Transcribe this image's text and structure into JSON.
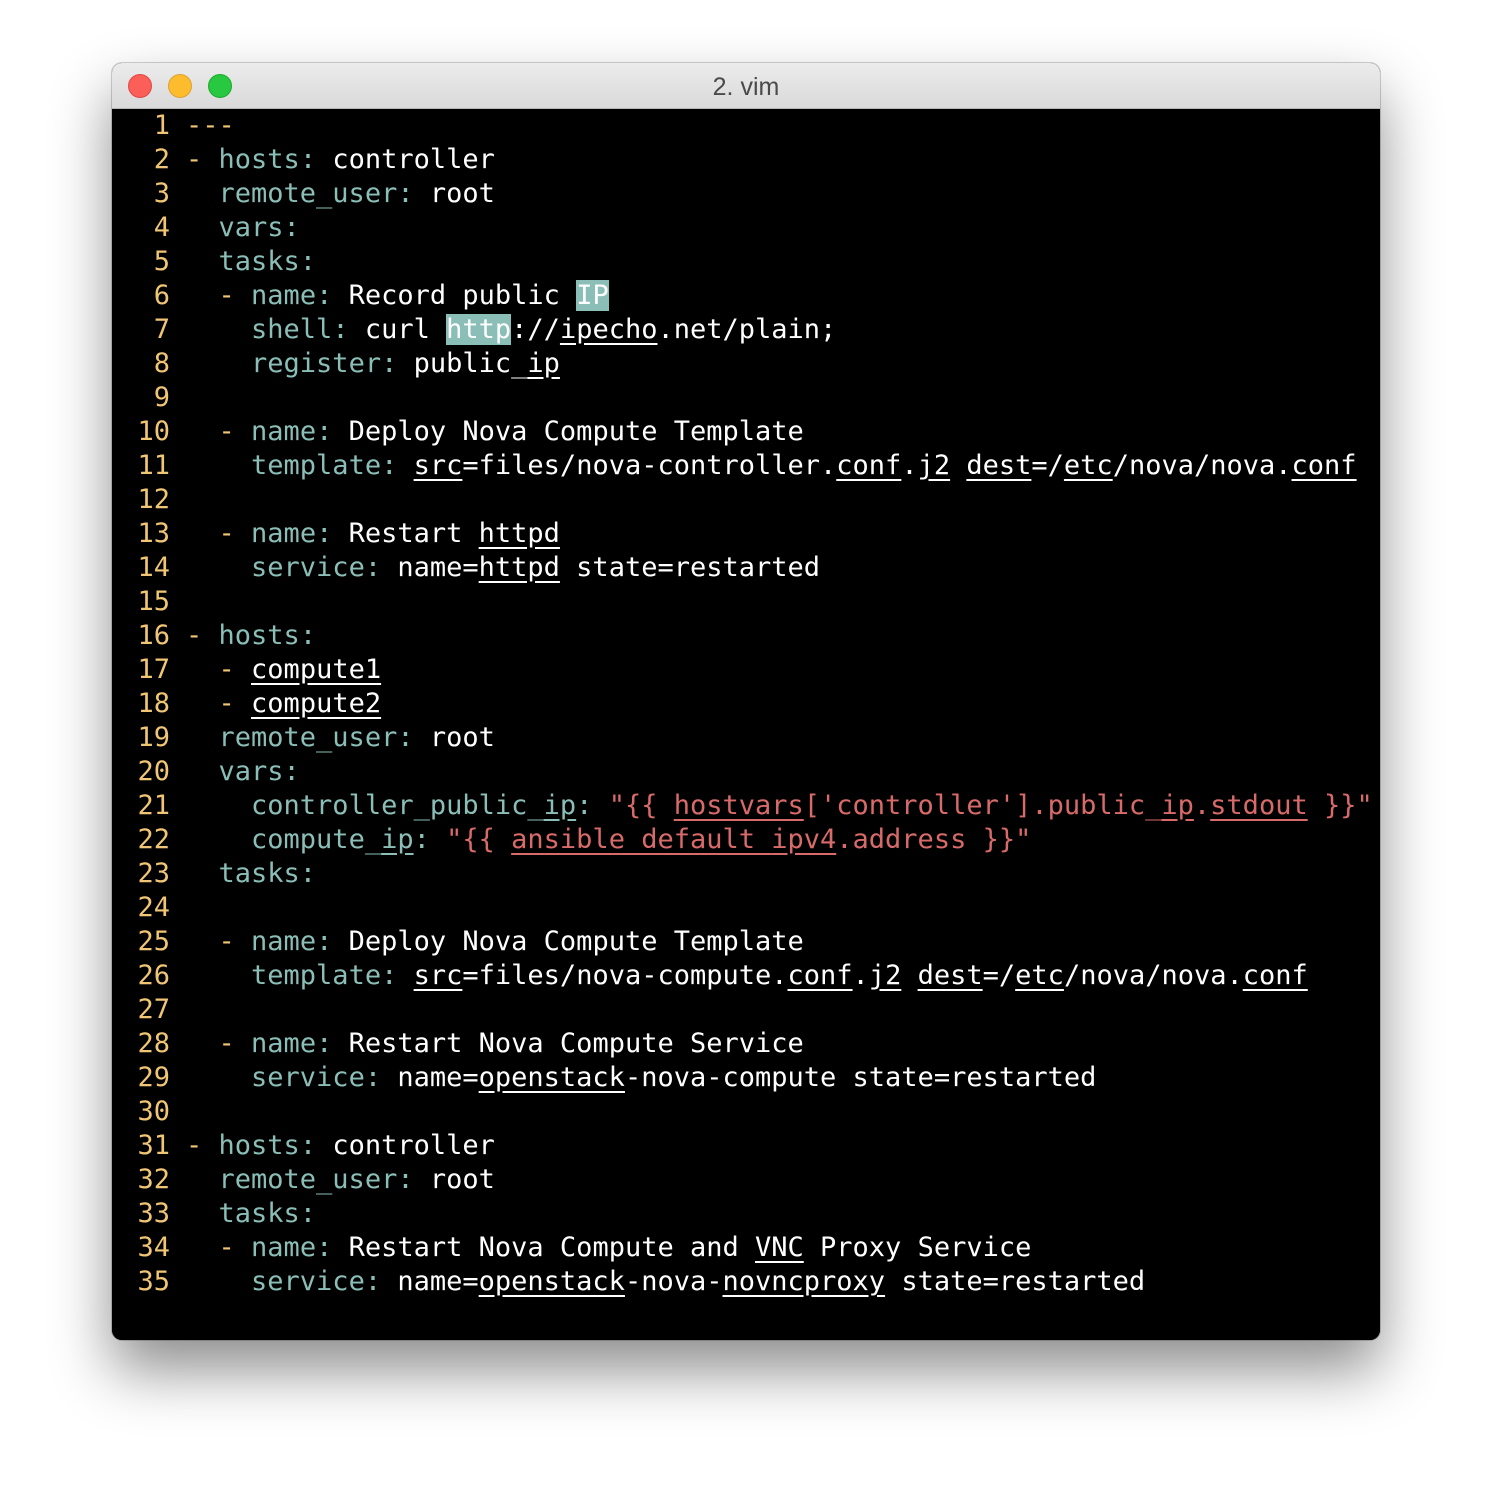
{
  "window": {
    "title": "2. vim"
  },
  "editor": {
    "line_numbers": [
      "1",
      "2",
      "3",
      "4",
      "5",
      "6",
      "7",
      "8",
      "9",
      "10",
      "11",
      "12",
      "13",
      "14",
      "15",
      "16",
      "17",
      "18",
      "19",
      "20",
      "21",
      "22",
      "23",
      "24",
      "25",
      "26",
      "27",
      "28",
      "29",
      "30",
      "31",
      "32",
      "33",
      "34",
      "35"
    ],
    "colors": {
      "background": "#000000",
      "line_number": "#f0c674",
      "key": "#8abeb7",
      "value": "#ffffff",
      "string": "#d96a6a",
      "search_highlight": "#8abeb7"
    },
    "tokens": {
      "l1_doc": "---",
      "dash": "-",
      "colon": ":",
      "k_hosts": "hosts",
      "k_remote_user": "remote_user",
      "k_vars": "vars",
      "k_tasks": "tasks",
      "k_name": "name",
      "k_shell": "shell",
      "k_register": "register",
      "k_template": "template",
      "k_service": "service",
      "k_controller_public_ip": "controller_public_ip",
      "k_compute_ip": "compute_ip",
      "v_controller": "controller",
      "v_root": "root",
      "l6_text": "Record public ",
      "l6_hl": "IP",
      "l7_curl": "curl ",
      "l7_hl": "http",
      "l7_a": "://",
      "l7_b": "ipecho",
      "l7_c": ".net/plain;",
      "l8_a": "public_",
      "l8_b": "ip",
      "v_deploy": "Deploy Nova Compute Template",
      "src": "src",
      "eq": "=",
      "l11_a": "files/nova-controller.",
      "conf": "conf",
      "dot": ".",
      "j2": "j2",
      "dest": "dest",
      "slash": "/",
      "etc": "etc",
      "nova_path": "/nova/nova.",
      "restart": "Restart ",
      "httpd": "httpd",
      "name_eq": "name=",
      "state_restarted": " state=restarted",
      "compute1": "compute1",
      "compute2": "compute2",
      "l21_a": "controller_public_",
      "l21_b": "ip",
      "l21_s1": "\"{{ ",
      "l21_s2": "hostvars",
      "l21_s3": "['controller'].public_",
      "l21_s4": "ip",
      "l21_s5": ".",
      "l21_s6": "stdout",
      "l21_s7": " }}\"",
      "l22_a": "compute_",
      "l22_b": "ip",
      "l22_s1": "\"{{ ",
      "l22_s2": "ansible_default_",
      "l22_s3": "ipv4",
      "l22_s4": ".address }}\"",
      "l26_a": "files/nova-compute.",
      "v_restart_nova": "Restart Nova Compute Service",
      "openstack": "openstack",
      "l29_b": "-nova-compute",
      "l34_a": "Restart Nova Compute and ",
      "vnc": "VNC",
      "l34_b": " Proxy Service",
      "l35_b": "-nova-",
      "novncproxy": "novncproxy",
      "state_restarted_35": " state=restarted"
    }
  }
}
